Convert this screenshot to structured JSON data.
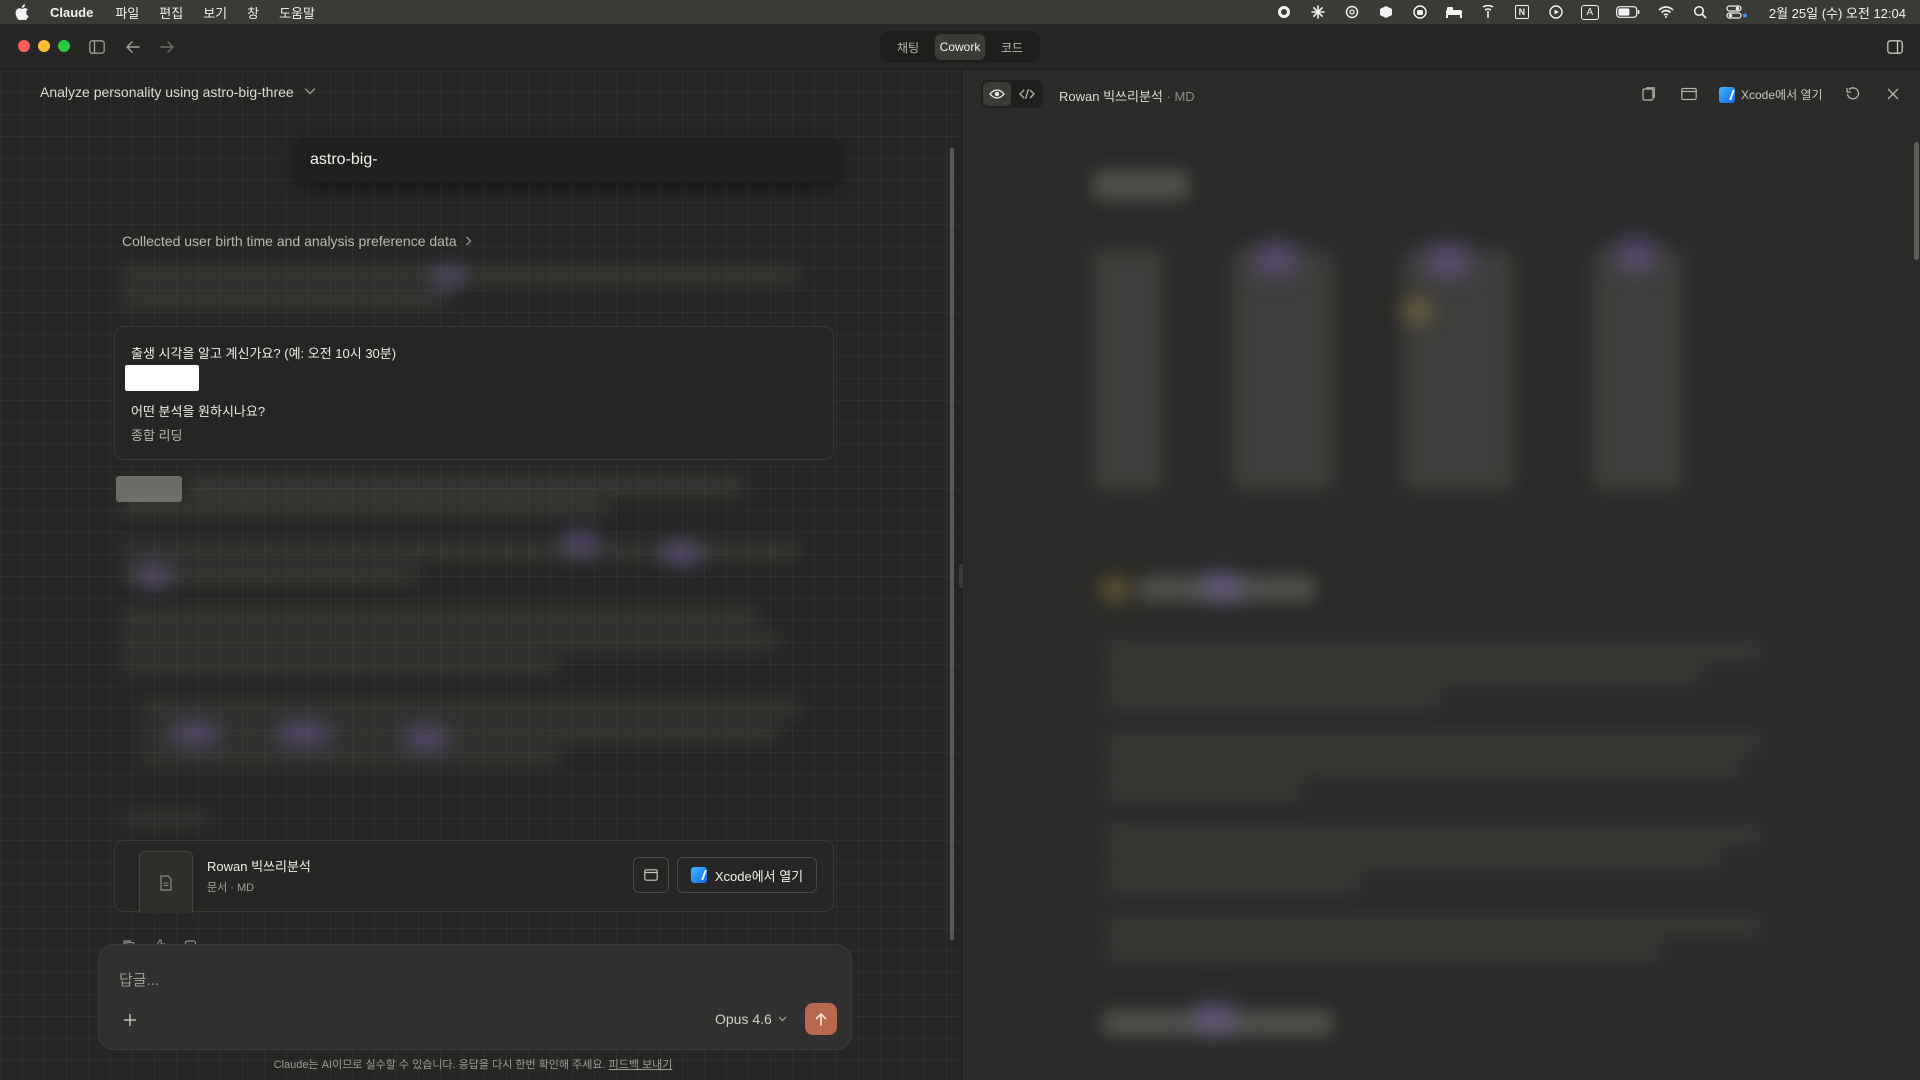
{
  "menubar": {
    "app_name": "Claude",
    "menus": [
      "파일",
      "편집",
      "보기",
      "창",
      "도움말"
    ],
    "status_icons": [
      "record-icon",
      "sparkle-icon",
      "chatgpt-icon",
      "box-icon",
      "copilot-icon",
      "bed-icon",
      "antenna-icon",
      "notion-icon",
      "play-icon",
      "input-source-icon",
      "battery-icon",
      "wifi-icon",
      "spotlight-icon",
      "control-center-icon"
    ],
    "input_source": "A",
    "notion_letter": "N",
    "clock": "2월 25일 (수) 오전 12:04"
  },
  "titlebar": {
    "modes": [
      {
        "label": "채팅",
        "active": false
      },
      {
        "label": "Cowork",
        "active": true
      },
      {
        "label": "코드",
        "active": false
      }
    ]
  },
  "chat": {
    "title": "Analyze personality using astro-big-three",
    "skill_chip": "astro-big-",
    "collected_label": "Collected user birth time and analysis preference data",
    "qa": {
      "question1": "출생 시각을 알고 계신가요? (예: 오전 10시 30분)",
      "question2": "어떤 분석을 원하시나요?",
      "answer2": "종합 리딩"
    },
    "file_card": {
      "name": "Rowan 빅쓰리분석",
      "meta": "문서 · MD",
      "open_label": "Xcode에서 열기"
    }
  },
  "composer": {
    "placeholder": "답글...",
    "model": "Opus 4.6"
  },
  "disclaimer": {
    "text": "Claude는 AI이므로 실수할 수 있습니다. 응답을 다시 한번 확인해 주세요.",
    "link": "피드백 보내기"
  },
  "preview": {
    "title": "Rowan 빅쓰리분석",
    "subtitle": " · MD",
    "open_label": "Xcode에서 열기"
  }
}
